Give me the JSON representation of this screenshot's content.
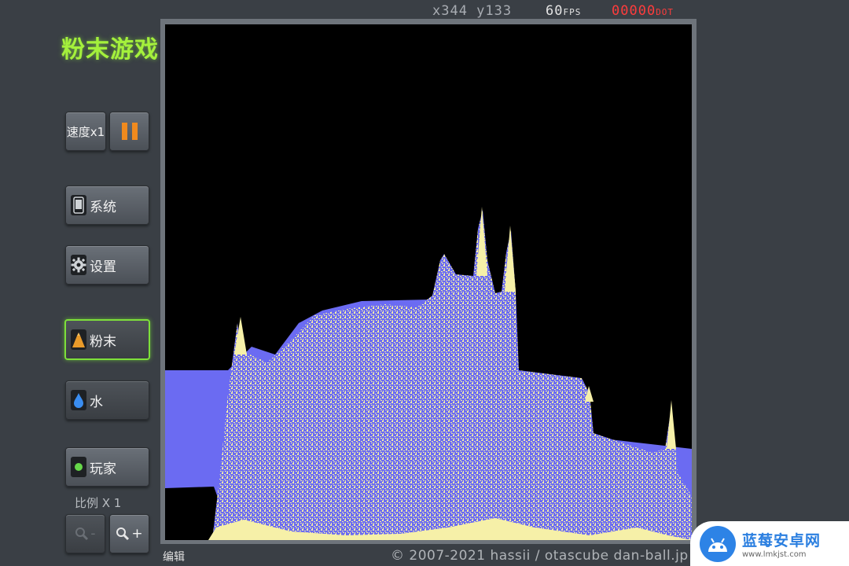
{
  "app": {
    "title": "粉末游戏"
  },
  "status": {
    "coords": "x344 y133",
    "fps_value": "60",
    "fps_unit": "FPS",
    "dots_value": "00000",
    "dots_unit": "DOT"
  },
  "toolbar": {
    "speed_label": "速度x1",
    "system_label": "系统",
    "settings_label": "设置",
    "powder_label": "粉末",
    "water_label": "水",
    "player_label": "玩家",
    "scale_label": "比例 X 1",
    "zoom_out_label": "-",
    "zoom_in_label": "+"
  },
  "footer": {
    "edit_label": "编辑",
    "copyright": "© 2007-2021 hassii / otascube dan-ball.jp"
  },
  "watermark": {
    "title": "蓝莓安卓网",
    "url": "www.lmkjst.com"
  },
  "colors": {
    "water": "#6b6bf2",
    "powder": "#f6f0a8",
    "accent": "#a4f03c",
    "pause": "#f08a1e"
  },
  "icons": [
    "phone-icon",
    "gear-icon",
    "powder-pile-icon",
    "water-drop-icon",
    "player-dot-icon",
    "zoom-out-icon",
    "zoom-in-icon",
    "pause-icon"
  ]
}
